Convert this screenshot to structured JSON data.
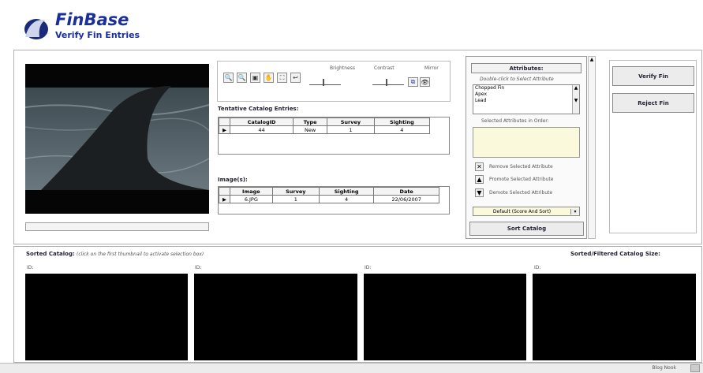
{
  "app": {
    "name": "FinBase",
    "subtitle": "Verify Fin Entries"
  },
  "toolbar": {
    "brightness_label": "Brightness",
    "contrast_label": "Contrast",
    "mirror_label": "Mirror"
  },
  "tentative": {
    "title": "Tentative Catalog Entries:",
    "headers": [
      "CatalogID",
      "Type",
      "Survey",
      "Sighting"
    ],
    "rows": [
      [
        "44",
        "New",
        "1",
        "4"
      ]
    ]
  },
  "images": {
    "title": "Image(s):",
    "headers": [
      "Image",
      "Survey",
      "Sighting",
      "Date"
    ],
    "rows": [
      [
        "6.JPG",
        "1",
        "4",
        "22/06/2007"
      ]
    ]
  },
  "attributes": {
    "title": "Attributes:",
    "hint": "Double-click to Select Attribute",
    "list": [
      "Chopped Fin",
      "Apex",
      "Lead"
    ],
    "selected_label": "Selected Attributes in Order:",
    "remove_label": "Remove Selected Attribute",
    "promote_label": "Promote Selected Attribute",
    "demote_label": "Demote Selected Attribute",
    "sort_mode": "Default (Score And Sort)",
    "sort_button": "Sort Catalog"
  },
  "actions": {
    "verify": "Verify Fin",
    "reject": "Reject Fin"
  },
  "sorted": {
    "title": "Sorted Catalog:",
    "hint": "(click on the first thumbnail to activate selection box)",
    "size_label": "Sorted/Filtered Catalog Size:",
    "id_label": "ID:"
  },
  "status": {
    "text": "Blog Nook"
  },
  "colors": {
    "title_blue": "#1a2f9a",
    "pale_yellow": "#fbf9dc",
    "panel_border": "#9a9a9a"
  }
}
